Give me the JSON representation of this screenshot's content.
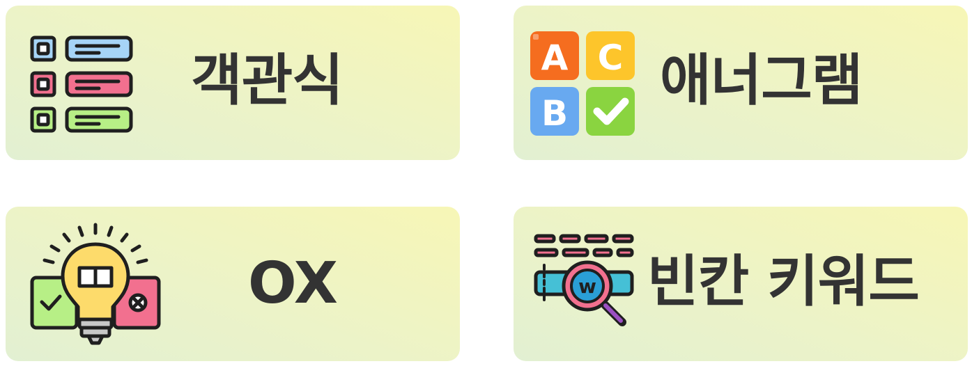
{
  "cards": [
    {
      "label": "객관식",
      "icon": "multiple-choice-list-icon"
    },
    {
      "label": "애너그램",
      "icon": "abc-blocks-icon",
      "letters": [
        "A",
        "C",
        "B"
      ]
    },
    {
      "label": "OX",
      "icon": "lightbulb-ox-icon"
    },
    {
      "label": "빈칸 키워드",
      "icon": "keyword-magnifier-icon",
      "magnifier_letter": "w"
    }
  ],
  "colors": {
    "text": "#333333",
    "card_gradient_start": "#e2f0d2",
    "card_gradient_end": "#f7f6b6",
    "orange": "#f56d1f",
    "yellow": "#fdc52b",
    "blue": "#68a9f0",
    "green": "#8ad440",
    "pink": "#f2708f",
    "light_green": "#b7ef86",
    "light_blue": "#a6d4f7"
  }
}
